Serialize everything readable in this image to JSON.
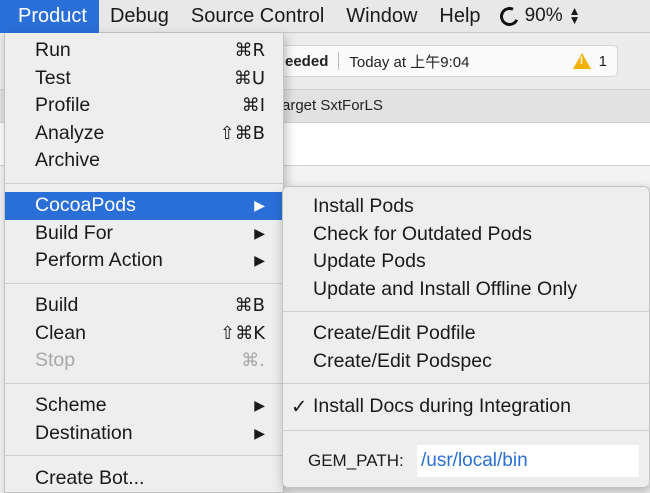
{
  "menubar": {
    "items": [
      "Product",
      "Debug",
      "Source Control",
      "Window",
      "Help"
    ],
    "battery": "90%"
  },
  "toolbar": {
    "build_status": "eeded",
    "time": "Today at 上午9:04",
    "warning_count": "1"
  },
  "navbar": {
    "target": "arget SxtForLS"
  },
  "product_menu": {
    "run": {
      "label": "Run",
      "shortcut": "⌘R"
    },
    "test": {
      "label": "Test",
      "shortcut": "⌘U"
    },
    "profile": {
      "label": "Profile",
      "shortcut": "⌘I"
    },
    "analyze": {
      "label": "Analyze",
      "shortcut": "⇧⌘B"
    },
    "archive": {
      "label": "Archive"
    },
    "cocoapods": {
      "label": "CocoaPods"
    },
    "build_for": {
      "label": "Build For"
    },
    "perform_action": {
      "label": "Perform Action"
    },
    "build": {
      "label": "Build",
      "shortcut": "⌘B"
    },
    "clean": {
      "label": "Clean",
      "shortcut": "⇧⌘K"
    },
    "stop": {
      "label": "Stop",
      "shortcut": "⌘."
    },
    "scheme": {
      "label": "Scheme"
    },
    "destination": {
      "label": "Destination"
    },
    "create_bot": {
      "label": "Create Bot..."
    },
    "arrow": "▶"
  },
  "cocoapods_menu": {
    "install_pods": "Install Pods",
    "check_outdated": "Check for Outdated Pods",
    "update_pods": "Update Pods",
    "update_offline": "Update and Install Offline Only",
    "edit_podfile": "Create/Edit Podfile",
    "edit_podspec": "Create/Edit Podspec",
    "install_docs": "Install Docs during Integration",
    "checkmark": "✓",
    "gem_path_label": "GEM_PATH:",
    "gem_path_value": "/usr/local/bin"
  },
  "colors": {
    "selection": "#2a6fd8",
    "warning": "#f3b20b",
    "disabled_text": "#a8a8a8"
  }
}
